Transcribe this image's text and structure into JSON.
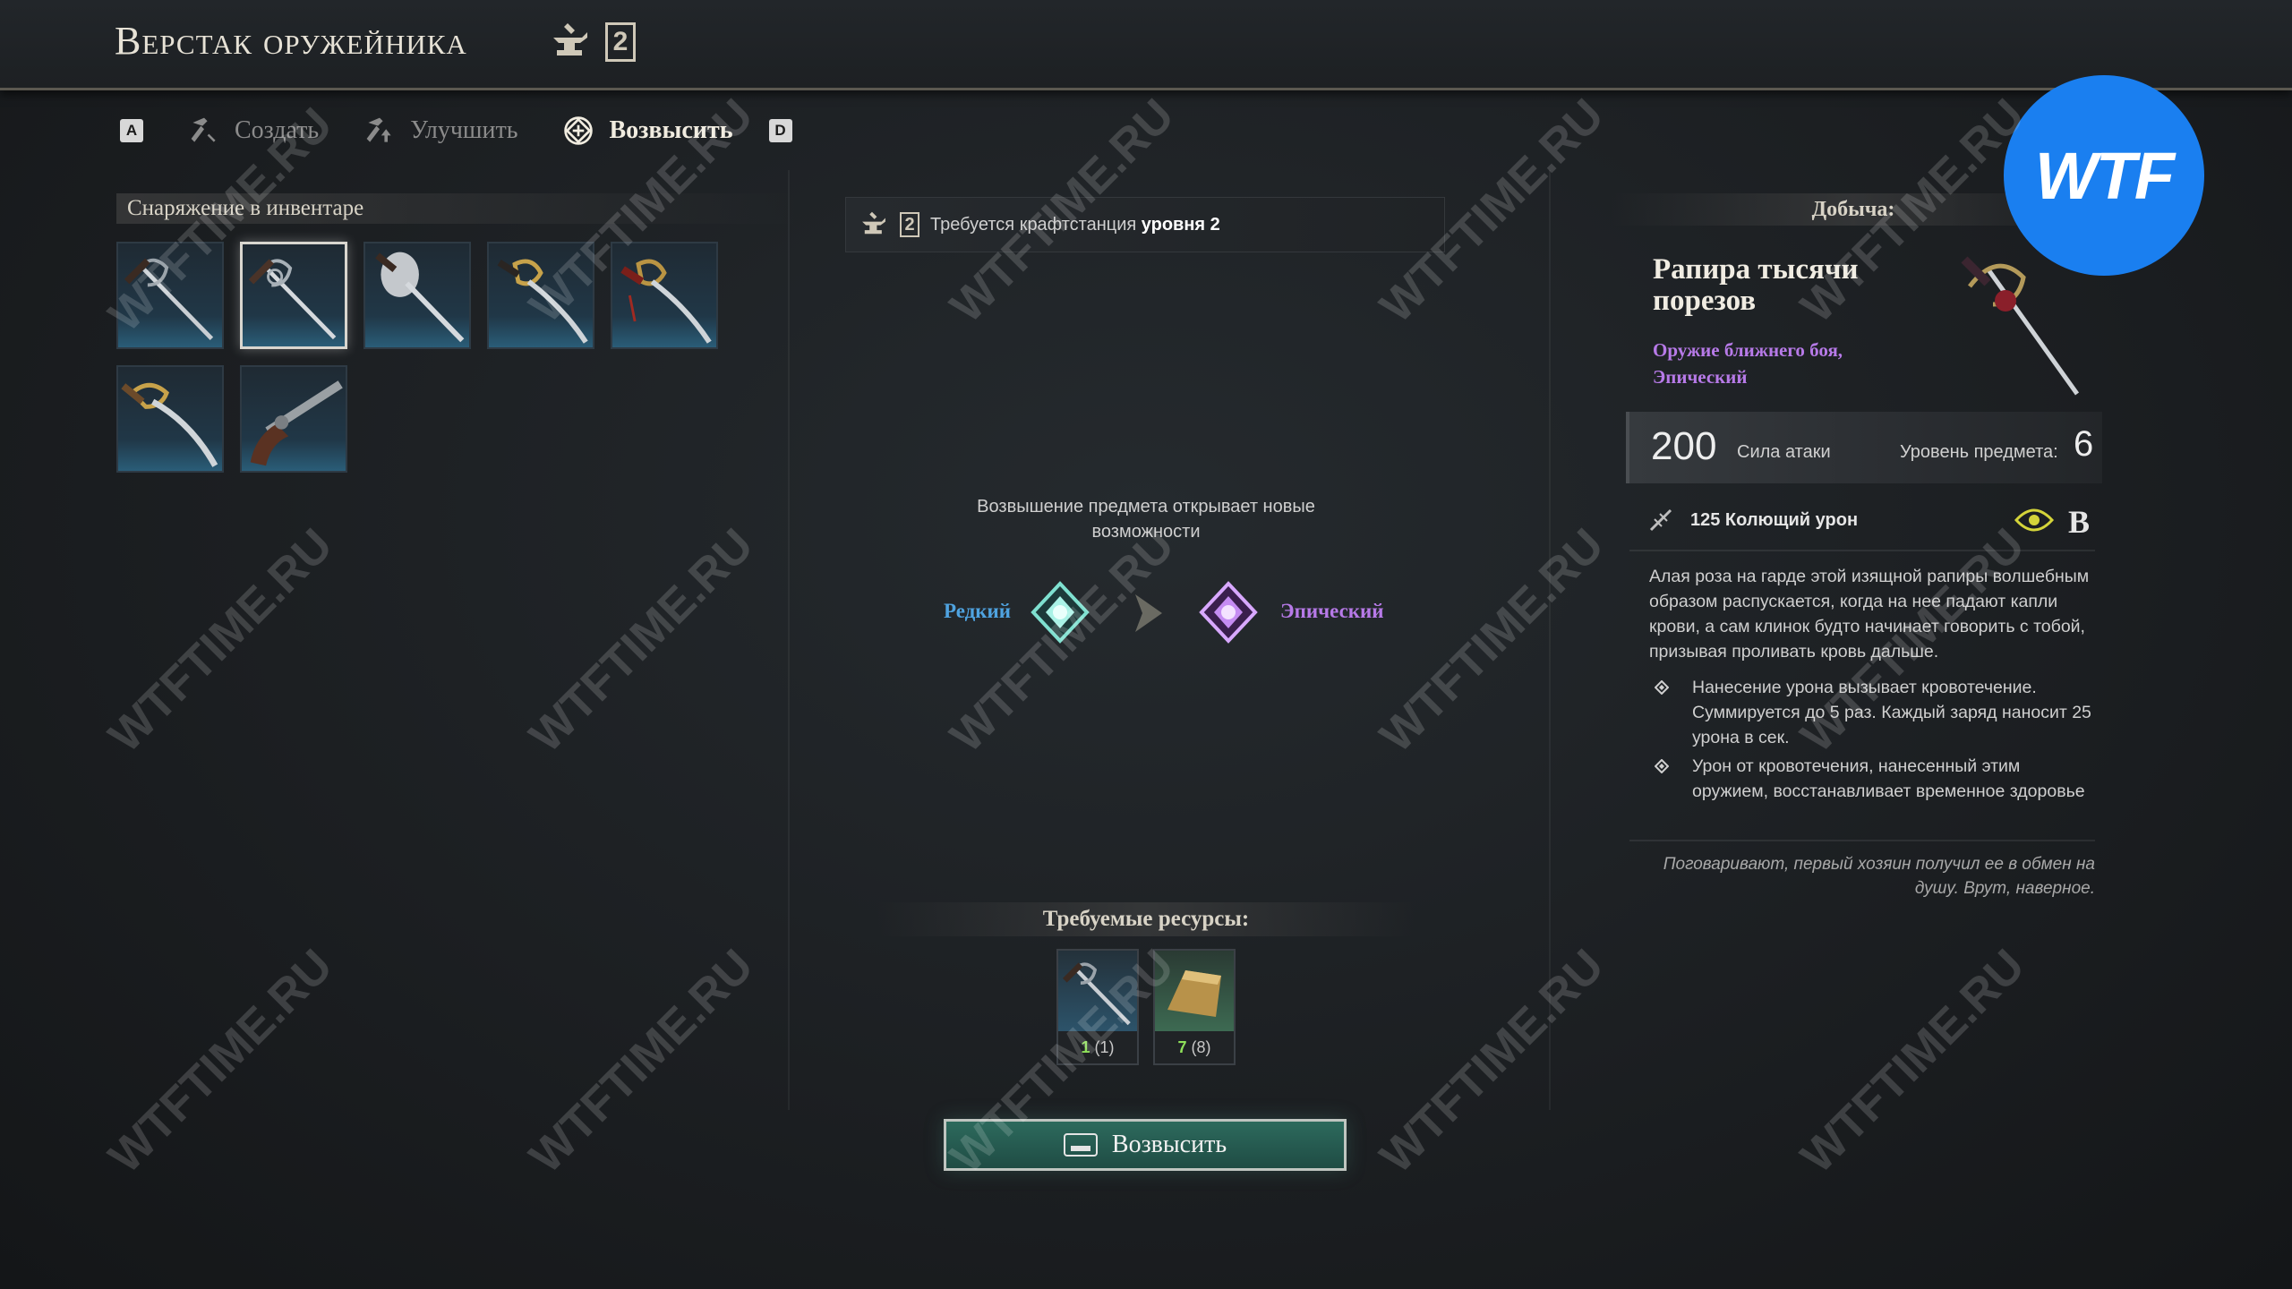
{
  "window": {
    "title": "Верстак оружейника",
    "station_level": "2"
  },
  "tabs": {
    "left_key": "A",
    "right_key": "D",
    "items": [
      {
        "label": "Создать",
        "icon": "hammer-icon",
        "active": false
      },
      {
        "label": "Улучшить",
        "icon": "hammer-up-icon",
        "active": false
      },
      {
        "label": "Возвысить",
        "icon": "ascend-icon",
        "active": true
      }
    ]
  },
  "inventory": {
    "title": "Снаряжение в инвентаре",
    "items": [
      {
        "name": "rapier-1",
        "selected": false
      },
      {
        "name": "rapier-2",
        "selected": true
      },
      {
        "name": "shell-guard-sword",
        "selected": false
      },
      {
        "name": "sabre-gold",
        "selected": false
      },
      {
        "name": "sabre-red",
        "selected": false
      },
      {
        "name": "cutlass",
        "selected": false
      },
      {
        "name": "flintlock-pistol",
        "selected": false
      }
    ]
  },
  "center": {
    "requirement_prefix": "Требуется крафтстанция",
    "requirement_bold": "уровня 2",
    "requirement_level": "2",
    "ascend_info": "Возвышение предмета открывает новые возможности",
    "rarity_from": "Редкий",
    "rarity_to": "Эпический",
    "resources_title": "Требуемые ресурсы:",
    "resources": [
      {
        "name": "rapier-resource",
        "have": "1",
        "need": "(1)"
      },
      {
        "name": "gold-ingot-resource",
        "have": "7",
        "need": "(8)"
      }
    ],
    "button_label": "Возвысить"
  },
  "loot": {
    "title": "Добыча:",
    "item_name": "Рапира тысячи порезов",
    "item_type": "Оружие ближнего боя, Эпический",
    "attack_value": "200",
    "attack_label": "Сила атаки",
    "level_label": "Уровень предмета:",
    "level_value": "6",
    "damage_text": "125 Колющий урон",
    "grade": "B",
    "lore": "Алая роза на гарде этой изящной рапиры волшебным образом распускается, когда на нее падают капли крови, а сам клинок будто начинает говорить с тобой, призывая проливать кровь дальше.",
    "perks": [
      "Нанесение урона вызывает кровотечение. Суммируется до 5 раз. Каждый заряд наносит 25 урона в сек.",
      "Урон от кровотечения, нанесенный этим оружием, восстанавливает временное здоровье"
    ],
    "quote": "Поговаривают, первый хозяин получил ее в обмен на душу. Врут, наверное."
  },
  "overlay": {
    "badge": "WTF",
    "watermark": "WTFTIME.RU"
  },
  "colors": {
    "rare": "#4fa3e0",
    "epic": "#b77ae8",
    "button": "#2d6a5d",
    "badge": "#1a7ff0"
  }
}
